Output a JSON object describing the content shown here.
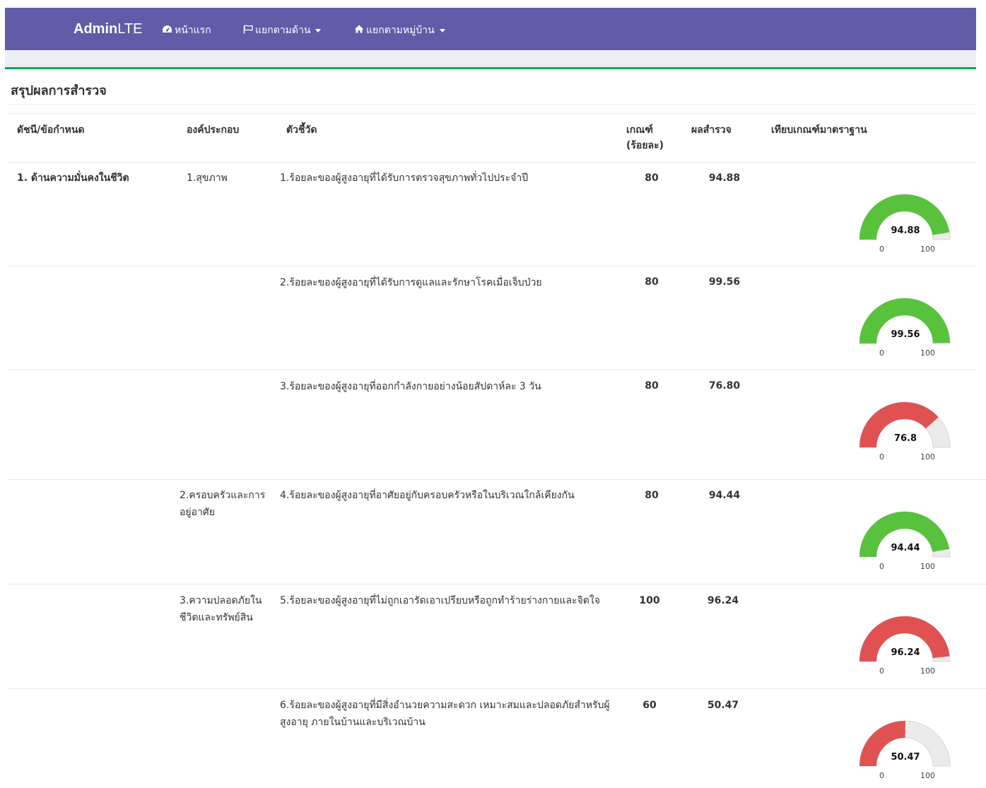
{
  "navbar": {
    "brand_bold": "Admin",
    "brand_light": "LTE",
    "items": [
      {
        "label": "หน้าแรก",
        "icon": "dashboard-icon",
        "dropdown": false
      },
      {
        "label": "แยกตามด้าน",
        "icon": "flag-icon",
        "dropdown": true
      },
      {
        "label": "แยกตามหมู่บ้าน",
        "icon": "home-icon",
        "dropdown": true
      }
    ],
    "bg_color": "#605ca8"
  },
  "box": {
    "title": "สรุปผลการสำรวจ"
  },
  "table": {
    "headers": {
      "index": "ดัชนี/ข้อกำหนด",
      "component": "องค์ประกอบ",
      "indicator": "ตัวชี้วัด",
      "criteria_line1": "เกณฑ์",
      "criteria_line2": "(ร้อยละ)",
      "result": "ผลสำรวจ",
      "compare": "เทียบเกณฑ์มาตราฐาน"
    },
    "rows": [
      {
        "index": "1. ด้านความมั่นคงในชีวิต",
        "component": "1.สุขภาพ",
        "indicator": "1.ร้อยละของผู้สูงอายุที่ได้รับการตรวจสุขภาพทั่วไปประจำปี",
        "criteria": "80",
        "result": "94.88",
        "gauge_label": "94.88",
        "gauge_value": 94.88,
        "gauge_color": "#58c23c"
      },
      {
        "index": "",
        "component": "",
        "indicator": "2.ร้อยละของผู้สูงอายุที่ได้รับการดูแลและรักษาโรคเมื่อเจ็บป่วย",
        "criteria": "80",
        "result": "99.56",
        "gauge_label": "99.56",
        "gauge_value": 99.56,
        "gauge_color": "#58c23c"
      },
      {
        "index": "",
        "component": "",
        "indicator": "3.ร้อยละของผู้สูงอายุที่ออกกำลังกายอย่างน้อยสัปดาห์ละ 3 วัน",
        "criteria": "80",
        "result": "76.80",
        "gauge_label": "76.8",
        "gauge_value": 76.8,
        "gauge_color": "#e05252"
      },
      {
        "index": "",
        "component": "2.ครอบครัวและการอยู่อาศัย",
        "indicator": "4.ร้อยละของผู้สูงอายุที่อาศัยอยู่กับครอบครัวหรือในบริเวณใกล้เคียงกัน",
        "criteria": "80",
        "result": "94.44",
        "gauge_label": "94.44",
        "gauge_value": 94.44,
        "gauge_color": "#58c23c"
      },
      {
        "index": "",
        "component": "3.ความปลอดภัยในชีวิตและทรัพย์สิน",
        "indicator": "5.ร้อยละของผู้สูงอายุที่ไม่ถูกเอารัดเอาเปรียบหรือถูกทำร้ายร่างกายและจิตใจ",
        "criteria": "100",
        "result": "96.24",
        "gauge_label": "96.24",
        "gauge_value": 96.24,
        "gauge_color": "#e05252"
      },
      {
        "index": "",
        "component": "",
        "indicator": "6.ร้อยละของผู้สูงอายุที่มีสิ่งอำนวยความสะดวก เหมาะสมและปลอดภัยสำหรับผู้สูงอายุ ภายในบ้านและบริเวณบ้าน",
        "criteria": "60",
        "result": "50.47",
        "gauge_label": "50.47",
        "gauge_value": 50.47,
        "gauge_color": "#e05252"
      }
    ],
    "gauge_min": "0",
    "gauge_max": "100",
    "gauge_track_color": "#ebebeb"
  }
}
